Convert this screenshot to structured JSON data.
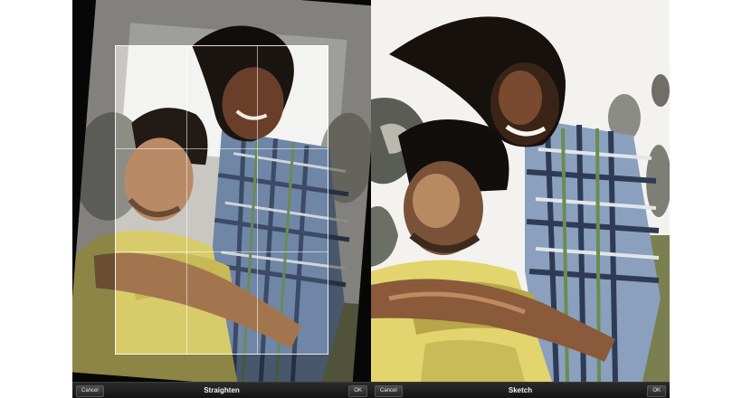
{
  "left_panel": {
    "toolbar": {
      "cancel_label": "Cancel",
      "title": "Straighten",
      "ok_label": "OK"
    }
  },
  "right_panel": {
    "toolbar": {
      "cancel_label": "Cancel",
      "title": "Sketch",
      "ok_label": "OK"
    }
  },
  "colors": {
    "toolbar_background": "#1e1e1e",
    "canvas_background": "#0c0c0c",
    "shirt_yellow": "#d8cc6a",
    "plaid_blue": "#6f86a6",
    "hair_dark": "#1b1512"
  }
}
